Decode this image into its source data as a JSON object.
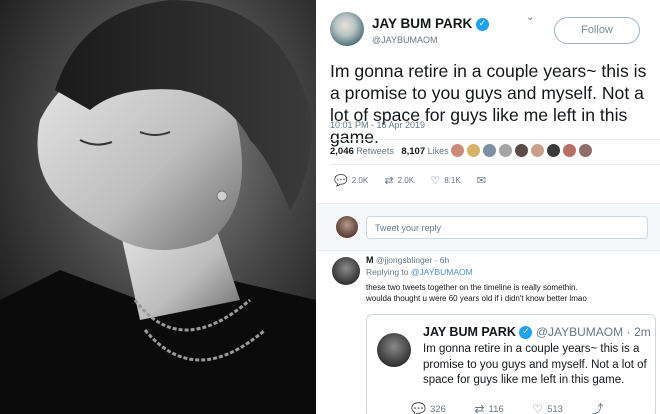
{
  "tweet": {
    "name": "JAY BUM PARK",
    "handle": "@JAYBUMAOM",
    "follow_label": "Follow",
    "menu_icon": "chevron-down-icon",
    "text": "Im gonna retire in a couple years~ this is a promise to you guys and myself.  Not a lot of space for guys like me left in this game.",
    "timestamp": "10:01 PM - 16 Apr 2019",
    "retweets_count": "2,046",
    "retweets_label": "Retweets",
    "likes_count": "8,107",
    "likes_label": "Likes",
    "actions": {
      "reply": "2.0K",
      "retweet": "2.0K",
      "like": "8.1K"
    },
    "verified_color": "#1da1f2"
  },
  "reply_box": {
    "placeholder": "Tweet your reply"
  },
  "reply": {
    "name": "M",
    "handle": "@jjongsblinger",
    "age": "6h",
    "replying_prefix": "Replying to",
    "replying_to": "@JAYBUMAOM",
    "text_line1": "these two tweets together on the timeline is really somethin.",
    "text_line2": "woulda thought u were 60 years old if i didn't know better lmao"
  },
  "quoted_tweet": {
    "name": "JAY BUM PARK",
    "handle": "@JAYBUMAOM",
    "age": "2m",
    "text": "Im gonna retire in a couple years~ this is a promise to you guys and myself.  Not a lot of space for guys like me left in this game.",
    "actions": {
      "reply": "326",
      "retweet": "116",
      "like": "513"
    }
  }
}
